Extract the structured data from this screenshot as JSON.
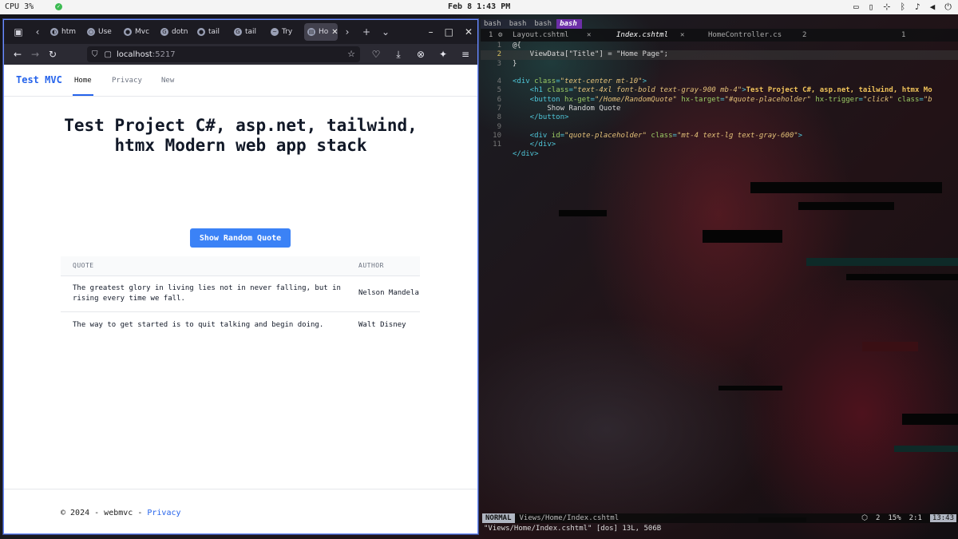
{
  "topbar": {
    "cpu": "CPU  3%",
    "clock": "Feb 8   1:43 PM"
  },
  "browser": {
    "tabs": [
      {
        "label": "htm"
      },
      {
        "label": "Use"
      },
      {
        "label": "Mvc"
      },
      {
        "label": "dotn"
      },
      {
        "label": "tail"
      },
      {
        "label": "tail"
      },
      {
        "label": "Try"
      },
      {
        "label": "Ho"
      }
    ],
    "url": {
      "host": "localhost",
      "port": ":5217"
    }
  },
  "site": {
    "brand": "Test MVC",
    "nav": [
      "Home",
      "Privacy",
      "New"
    ],
    "heading": "Test Project C#, asp.net, tailwind, htmx Modern web app stack",
    "button": "Show Random Quote",
    "table": {
      "headers": [
        "QUOTE",
        "AUTHOR"
      ],
      "rows": [
        {
          "quote": "The greatest glory in living lies not in never falling, but in rising every time we fall.",
          "author": "Nelson Mandela"
        },
        {
          "quote": "The way to get started is to quit talking and begin doing.",
          "author": "Walt Disney"
        }
      ]
    },
    "footer": {
      "text": "© 2024 - webmvc - ",
      "link": "Privacy"
    }
  },
  "terminal": {
    "tabs": [
      "bash",
      "bash",
      "bash",
      "bash"
    ],
    "buffer_index": "1",
    "buffers": [
      "Layout.cshtml",
      "Index.cshtml",
      "HomeController.cs",
      "2"
    ],
    "right_index": "1",
    "lines": [
      "@{",
      "    ViewData[\"Title\"] = \"Home Page\";",
      "}",
      "",
      "<div class=\"text-center mt-10\">",
      "    <h1 class=\"text-4xl font-bold text-gray-900 mb-4\">Test Project C#, asp.net, tailwind, htmx Mo",
      "    <button hx-get=\"/Home/RandomQuote\" hx-target=\"#quote-placeholder\" hx-trigger=\"click\" class=\"b",
      "        Show Random Quote",
      "    </button>",
      "",
      "    <div id=\"quote-placeholder\" class=\"mt-4 text-lg text-gray-600\">",
      "    </div>",
      "</div>"
    ],
    "line_numbers": [
      "1",
      "2",
      "3",
      "4",
      "5",
      "6",
      "7",
      "8",
      "9",
      "10",
      "11"
    ],
    "status": {
      "mode": "NORMAL",
      "path": "Views/Home/Index.cshtml",
      "col": "2",
      "percent": "15%",
      "pos": "2:1",
      "time": "13:43"
    },
    "cmdline": "\"Views/Home/Index.cshtml\" [dos] 13L, 506B"
  }
}
